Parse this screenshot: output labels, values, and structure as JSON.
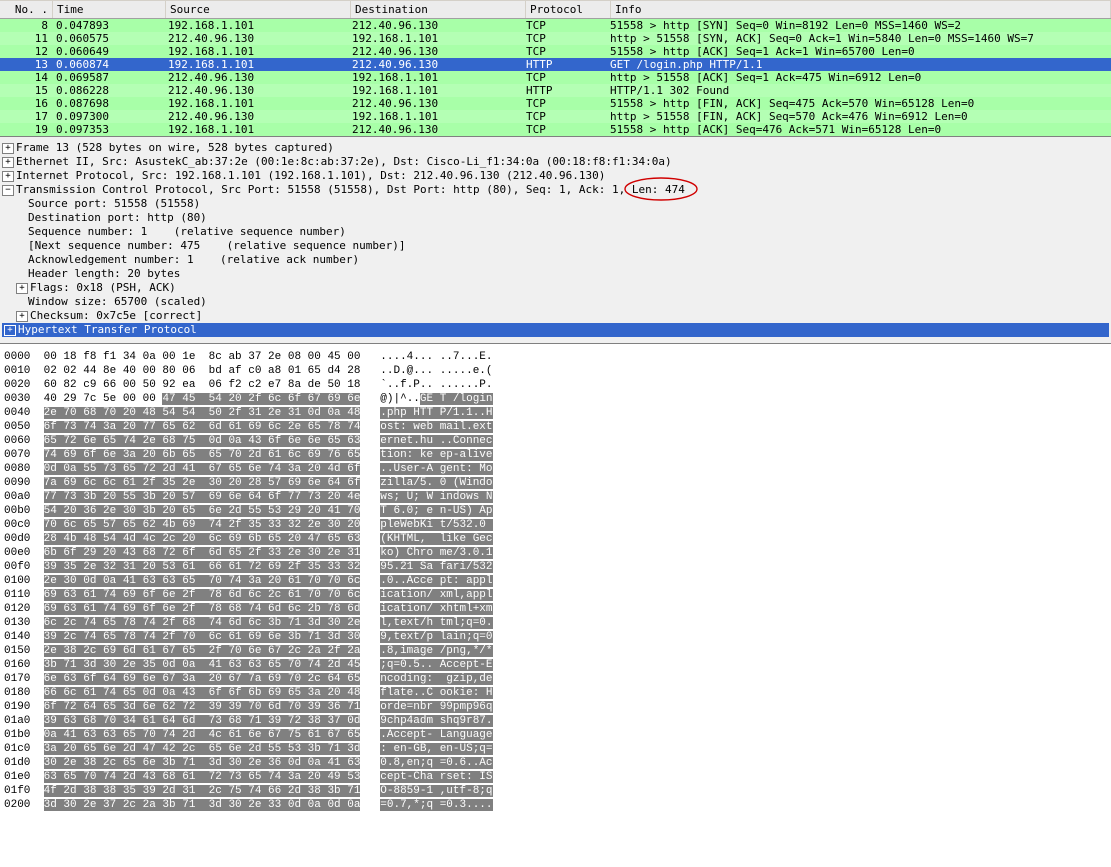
{
  "headers": {
    "no": "No. .",
    "time": "Time",
    "src": "Source",
    "dst": "Destination",
    "proto": "Protocol",
    "info": "Info"
  },
  "packets": [
    {
      "no": "8",
      "time": "0.047893",
      "src": "192.168.1.101",
      "dst": "212.40.96.130",
      "proto": "TCP",
      "info": "51558 > http [SYN] Seq=0 Win=8192 Len=0 MSS=1460 WS=2",
      "sel": false
    },
    {
      "no": "11",
      "time": "0.060575",
      "src": "212.40.96.130",
      "dst": "192.168.1.101",
      "proto": "TCP",
      "info": "http > 51558 [SYN, ACK] Seq=0 Ack=1 Win=5840 Len=0 MSS=1460 WS=7",
      "sel": false
    },
    {
      "no": "12",
      "time": "0.060649",
      "src": "192.168.1.101",
      "dst": "212.40.96.130",
      "proto": "TCP",
      "info": "51558 > http [ACK] Seq=1 Ack=1 Win=65700 Len=0",
      "sel": false
    },
    {
      "no": "13",
      "time": "0.060874",
      "src": "192.168.1.101",
      "dst": "212.40.96.130",
      "proto": "HTTP",
      "info": "GET /login.php HTTP/1.1",
      "sel": true
    },
    {
      "no": "14",
      "time": "0.069587",
      "src": "212.40.96.130",
      "dst": "192.168.1.101",
      "proto": "TCP",
      "info": "http > 51558 [ACK] Seq=1 Ack=475 Win=6912 Len=0",
      "sel": false
    },
    {
      "no": "15",
      "time": "0.086228",
      "src": "212.40.96.130",
      "dst": "192.168.1.101",
      "proto": "HTTP",
      "info": "HTTP/1.1 302 Found",
      "sel": false
    },
    {
      "no": "16",
      "time": "0.087698",
      "src": "192.168.1.101",
      "dst": "212.40.96.130",
      "proto": "TCP",
      "info": "51558 > http [FIN, ACK] Seq=475 Ack=570 Win=65128 Len=0",
      "sel": false
    },
    {
      "no": "17",
      "time": "0.097300",
      "src": "212.40.96.130",
      "dst": "192.168.1.101",
      "proto": "TCP",
      "info": "http > 51558 [FIN, ACK] Seq=570 Ack=476 Win=6912 Len=0",
      "sel": false
    },
    {
      "no": "19",
      "time": "0.097353",
      "src": "192.168.1.101",
      "dst": "212.40.96.130",
      "proto": "TCP",
      "info": "51558 > http [ACK] Seq=476 Ack=571 Win=65128 Len=0",
      "sel": false
    }
  ],
  "details": {
    "frame": "Frame 13 (528 bytes on wire, 528 bytes captured)",
    "eth": "Ethernet II, Src: AsustekC_ab:37:2e (00:1e:8c:ab:37:2e), Dst: Cisco-Li_f1:34:0a (00:18:f8:f1:34:0a)",
    "ip": "Internet Protocol, Src: 192.168.1.101 (192.168.1.101), Dst: 212.40.96.130 (212.40.96.130)",
    "tcp_pre": "Transmission Control Protocol, Src Port: 51558 (51558), Dst Port: http (80), Seq: 1, Ack: 1, ",
    "tcp_len": "Len: 474",
    "srcport": "Source port: 51558 (51558)",
    "dstport": "Destination port: http (80)",
    "seq": "Sequence number: 1    (relative sequence number)",
    "nextseq": "[Next sequence number: 475    (relative sequence number)]",
    "ack": "Acknowledgement number: 1    (relative ack number)",
    "hdrlen": "Header length: 20 bytes",
    "flags": "Flags: 0x18 (PSH, ACK)",
    "win": "Window size: 65700 (scaled)",
    "cksum": "Checksum: 0x7c5e [correct]",
    "http": "Hypertext Transfer Protocol"
  },
  "hex": [
    {
      "off": "0000",
      "p": "00 18 f8 f1 34 0a 00 1e  8c ab 37 2e 08 00 45 00",
      "h": "",
      "ap": "....4... ..7...E.",
      "ah": ""
    },
    {
      "off": "0010",
      "p": "02 02 44 8e 40 00 80 06  bd af c0 a8 01 65 d4 28",
      "h": "",
      "ap": "..D.@... .....e.(",
      "ah": ""
    },
    {
      "off": "0020",
      "p": "60 82 c9 66 00 50 92 ea  06 f2 c2 e7 8a de 50 18",
      "h": "",
      "ap": "`..f.P.. ......P.",
      "ah": ""
    },
    {
      "off": "0030",
      "p": "40 29 7c 5e 00 00 ",
      "h": "47 45  54 20 2f 6c 6f 67 69 6e",
      "ap": "@)|^..",
      "ah": "GE T /login"
    },
    {
      "off": "0040",
      "p": "",
      "h": "2e 70 68 70 20 48 54 54  50 2f 31 2e 31 0d 0a 48",
      "ap": "",
      "ah": ".php HTT P/1.1..H"
    },
    {
      "off": "0050",
      "p": "",
      "h": "6f 73 74 3a 20 77 65 62  6d 61 69 6c 2e 65 78 74",
      "ap": "",
      "ah": "ost: web mail.ext"
    },
    {
      "off": "0060",
      "p": "",
      "h": "65 72 6e 65 74 2e 68 75  0d 0a 43 6f 6e 6e 65 63",
      "ap": "",
      "ah": "ernet.hu ..Connec"
    },
    {
      "off": "0070",
      "p": "",
      "h": "74 69 6f 6e 3a 20 6b 65  65 70 2d 61 6c 69 76 65",
      "ap": "",
      "ah": "tion: ke ep-alive"
    },
    {
      "off": "0080",
      "p": "",
      "h": "0d 0a 55 73 65 72 2d 41  67 65 6e 74 3a 20 4d 6f",
      "ap": "",
      "ah": "..User-A gent: Mo"
    },
    {
      "off": "0090",
      "p": "",
      "h": "7a 69 6c 6c 61 2f 35 2e  30 20 28 57 69 6e 64 6f",
      "ap": "",
      "ah": "zilla/5. 0 (Windo"
    },
    {
      "off": "00a0",
      "p": "",
      "h": "77 73 3b 20 55 3b 20 57  69 6e 64 6f 77 73 20 4e",
      "ap": "",
      "ah": "ws; U; W indows N"
    },
    {
      "off": "00b0",
      "p": "",
      "h": "54 20 36 2e 30 3b 20 65  6e 2d 55 53 29 20 41 70",
      "ap": "",
      "ah": "T 6.0; e n-US) Ap"
    },
    {
      "off": "00c0",
      "p": "",
      "h": "70 6c 65 57 65 62 4b 69  74 2f 35 33 32 2e 30 20",
      "ap": "",
      "ah": "pleWebKi t/532.0 "
    },
    {
      "off": "00d0",
      "p": "",
      "h": "28 4b 48 54 4d 4c 2c 20  6c 69 6b 65 20 47 65 63",
      "ap": "",
      "ah": "(KHTML,  like Gec"
    },
    {
      "off": "00e0",
      "p": "",
      "h": "6b 6f 29 20 43 68 72 6f  6d 65 2f 33 2e 30 2e 31",
      "ap": "",
      "ah": "ko) Chro me/3.0.1"
    },
    {
      "off": "00f0",
      "p": "",
      "h": "39 35 2e 32 31 20 53 61  66 61 72 69 2f 35 33 32",
      "ap": "",
      "ah": "95.21 Sa fari/532"
    },
    {
      "off": "0100",
      "p": "",
      "h": "2e 30 0d 0a 41 63 63 65  70 74 3a 20 61 70 70 6c",
      "ap": "",
      "ah": ".0..Acce pt: appl"
    },
    {
      "off": "0110",
      "p": "",
      "h": "69 63 61 74 69 6f 6e 2f  78 6d 6c 2c 61 70 70 6c",
      "ap": "",
      "ah": "ication/ xml,appl"
    },
    {
      "off": "0120",
      "p": "",
      "h": "69 63 61 74 69 6f 6e 2f  78 68 74 6d 6c 2b 78 6d",
      "ap": "",
      "ah": "ication/ xhtml+xm"
    },
    {
      "off": "0130",
      "p": "",
      "h": "6c 2c 74 65 78 74 2f 68  74 6d 6c 3b 71 3d 30 2e",
      "ap": "",
      "ah": "l,text/h tml;q=0."
    },
    {
      "off": "0140",
      "p": "",
      "h": "39 2c 74 65 78 74 2f 70  6c 61 69 6e 3b 71 3d 30",
      "ap": "",
      "ah": "9,text/p lain;q=0"
    },
    {
      "off": "0150",
      "p": "",
      "h": "2e 38 2c 69 6d 61 67 65  2f 70 6e 67 2c 2a 2f 2a",
      "ap": "",
      "ah": ".8,image /png,*/*"
    },
    {
      "off": "0160",
      "p": "",
      "h": "3b 71 3d 30 2e 35 0d 0a  41 63 63 65 70 74 2d 45",
      "ap": "",
      "ah": ";q=0.5.. Accept-E"
    },
    {
      "off": "0170",
      "p": "",
      "h": "6e 63 6f 64 69 6e 67 3a  20 67 7a 69 70 2c 64 65",
      "ap": "",
      "ah": "ncoding:  gzip,de"
    },
    {
      "off": "0180",
      "p": "",
      "h": "66 6c 61 74 65 0d 0a 43  6f 6f 6b 69 65 3a 20 48",
      "ap": "",
      "ah": "flate..C ookie: H"
    },
    {
      "off": "0190",
      "p": "",
      "h": "6f 72 64 65 3d 6e 62 72  39 39 70 6d 70 39 36 71",
      "ap": "",
      "ah": "orde=nbr 99pmp96q"
    },
    {
      "off": "01a0",
      "p": "",
      "h": "39 63 68 70 34 61 64 6d  73 68 71 39 72 38 37 0d",
      "ap": "",
      "ah": "9chp4adm shq9r87."
    },
    {
      "off": "01b0",
      "p": "",
      "h": "0a 41 63 63 65 70 74 2d  4c 61 6e 67 75 61 67 65",
      "ap": "",
      "ah": ".Accept- Language"
    },
    {
      "off": "01c0",
      "p": "",
      "h": "3a 20 65 6e 2d 47 42 2c  65 6e 2d 55 53 3b 71 3d",
      "ap": "",
      "ah": ": en-GB, en-US;q="
    },
    {
      "off": "01d0",
      "p": "",
      "h": "30 2e 38 2c 65 6e 3b 71  3d 30 2e 36 0d 0a 41 63",
      "ap": "",
      "ah": "0.8,en;q =0.6..Ac"
    },
    {
      "off": "01e0",
      "p": "",
      "h": "63 65 70 74 2d 43 68 61  72 73 65 74 3a 20 49 53",
      "ap": "",
      "ah": "cept-Cha rset: IS"
    },
    {
      "off": "01f0",
      "p": "",
      "h": "4f 2d 38 38 35 39 2d 31  2c 75 74 66 2d 38 3b 71",
      "ap": "",
      "ah": "O-8859-1 ,utf-8;q"
    },
    {
      "off": "0200",
      "p": "",
      "h": "3d 30 2e 37 2c 2a 3b 71  3d 30 2e 33 0d 0a 0d 0a",
      "ap": "",
      "ah": "=0.7,*;q =0.3...."
    }
  ]
}
